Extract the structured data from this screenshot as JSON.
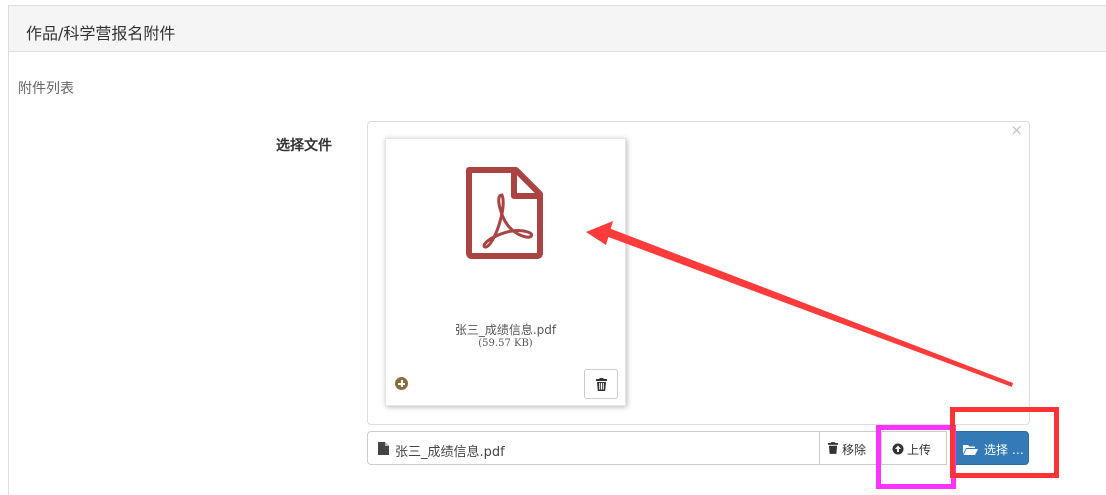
{
  "panel": {
    "title": "作品/科学营报名附件"
  },
  "section_label": "附件列表",
  "field_label": "选择文件",
  "preview": {
    "close_glyph": "×",
    "file_name": "张三_成绩信息.pdf",
    "file_size": "(59.57 KB)",
    "icon": "file-pdf-icon",
    "icon_color": "#a94442"
  },
  "file_input": {
    "caption": "张三_成绩信息.pdf"
  },
  "buttons": {
    "remove": "移除",
    "upload": "上传",
    "browse": "选择 …"
  },
  "colors": {
    "primary": "#337ab7",
    "annotation_magenta": "#ff33ff",
    "annotation_red": "#ff3333"
  }
}
